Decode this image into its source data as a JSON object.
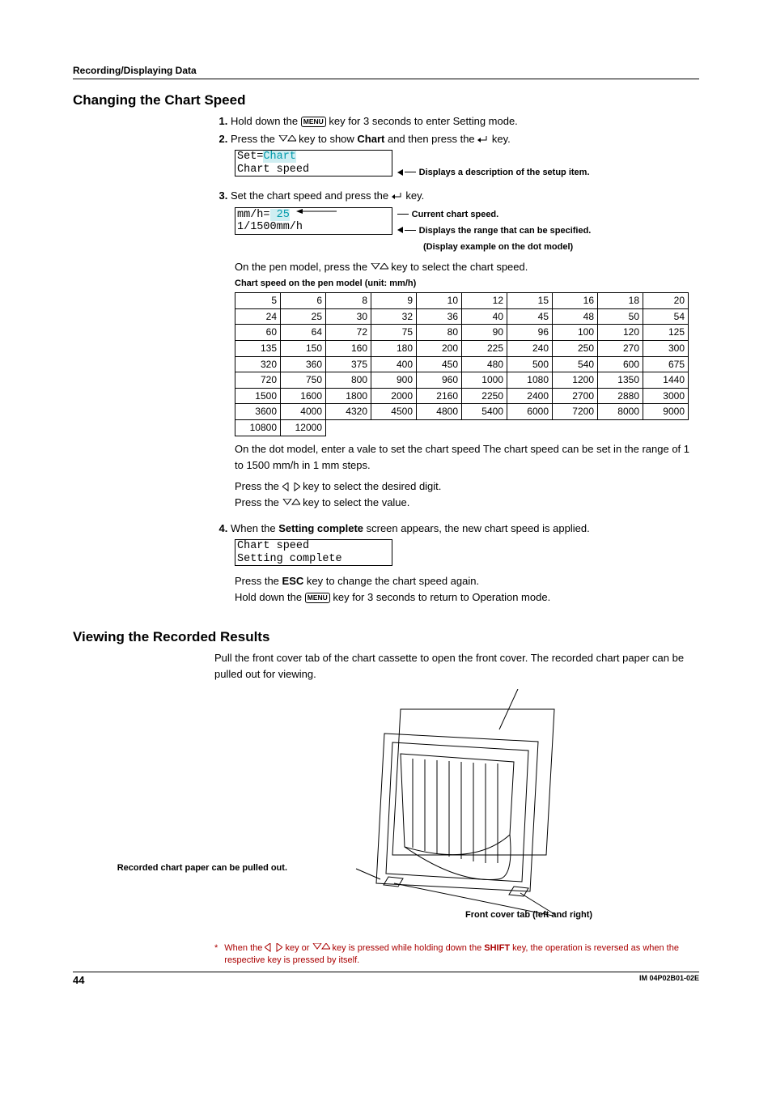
{
  "header": {
    "breadcrumb": "Recording/Displaying Data"
  },
  "section1": {
    "title": "Changing the Chart Speed",
    "step1": {
      "pre": "Hold down the ",
      "key": "MENU",
      "post": " key for 3 seconds to enter Setting mode."
    },
    "step2": {
      "t1": "Press the ",
      "t2": " key to show ",
      "bold": "Chart",
      "t3": " and then press the ",
      "t4": " key.",
      "lcd_line1_a": "Set=",
      "lcd_line1_b": "Chart",
      "lcd_line2": "Chart speed",
      "ann": "Displays a description of the setup item."
    },
    "step3": {
      "t1": "Set the chart speed and press the ",
      "t2": " key.",
      "lcd_line1_a": "mm/h=",
      "lcd_line1_b": " 25",
      "lcd_line2": "1/1500mm/h",
      "ann1": "Current chart speed.",
      "ann2": "Displays the range that can be specified.",
      "ann3": "(Display example on the dot model)",
      "p1a": "On the pen model, press the ",
      "p1b": " key to select the chart speed.",
      "caption": "Chart speed on the pen model (unit: mm/h)",
      "p2": "On the dot model, enter a vale to set the chart speed The chart speed can be set in the range of 1 to 1500 mm/h in 1 mm steps.",
      "p3a": "Press the ",
      "p3b": " key to select the desired digit.",
      "p4a": "Press the ",
      "p4b": " key to select the value."
    },
    "step4": {
      "t1": "When the ",
      "bold": "Setting complete",
      "t2": " screen appears, the new chart speed is applied.",
      "lcd_line1": "Chart speed",
      "lcd_line2": "Setting complete",
      "p1a": "Press the ",
      "p1bold": "ESC",
      "p1b": " key to change the chart speed again.",
      "p2a": "Hold down the ",
      "p2key": "MENU",
      "p2b": " key for 3 seconds to return to Operation mode."
    }
  },
  "chart_data": {
    "type": "table",
    "title": "Chart speed on the pen model (unit: mm/h)",
    "rows": [
      [
        5,
        6,
        8,
        9,
        10,
        12,
        15,
        16,
        18,
        20
      ],
      [
        24,
        25,
        30,
        32,
        36,
        40,
        45,
        48,
        50,
        54
      ],
      [
        60,
        64,
        72,
        75,
        80,
        90,
        96,
        100,
        120,
        125
      ],
      [
        135,
        150,
        160,
        180,
        200,
        225,
        240,
        250,
        270,
        300
      ],
      [
        320,
        360,
        375,
        400,
        450,
        480,
        500,
        540,
        600,
        675
      ],
      [
        720,
        750,
        800,
        900,
        960,
        1000,
        1080,
        1200,
        1350,
        1440
      ],
      [
        1500,
        1600,
        1800,
        2000,
        2160,
        2250,
        2400,
        2700,
        2880,
        3000
      ],
      [
        3600,
        4000,
        4320,
        4500,
        4800,
        5400,
        6000,
        7200,
        8000,
        9000
      ],
      [
        10800,
        12000
      ]
    ]
  },
  "section2": {
    "title": "Viewing the Recorded Results",
    "p1": "Pull the front cover tab of the chart cassette to open the front cover. The recorded chart paper can be pulled out for viewing.",
    "label1": "Recorded chart paper can be pulled out.",
    "label2": "Front cover tab (left and right)"
  },
  "footnote": {
    "t1": "When the ",
    "t2": " key or ",
    "t3": " key is pressed while holding down the ",
    "bold": "SHIFT",
    "t4": " key, the operation is reversed as when the respective key is pressed by itself."
  },
  "footer": {
    "page": "44",
    "docid": "IM 04P02B01-02E"
  }
}
